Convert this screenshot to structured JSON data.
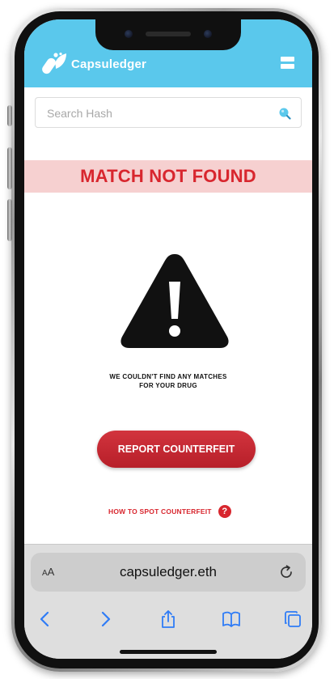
{
  "header": {
    "brand": "Capsuledger",
    "background_color": "#5ac8ec",
    "logo_icon": "capsule-leaf-logo",
    "menu_icon": "hamburger-menu-icon"
  },
  "search": {
    "placeholder": "Search Hash",
    "value": "",
    "icon": "search-icon"
  },
  "result": {
    "banner_text": "MATCH NOT FOUND",
    "banner_color": "#d8262e",
    "banner_background": "#f6d0d0",
    "icon": "warning-icon",
    "message_line1": "WE COULDN'T FIND ANY MATCHES",
    "message_line2": "FOR YOUR DRUG"
  },
  "actions": {
    "report_label": "REPORT COUNTERFEIT",
    "spot_label": "HOW TO SPOT COUNTERFEIT",
    "help_icon_glyph": "?"
  },
  "browser": {
    "text_size_label_small": "A",
    "text_size_label_large": "A",
    "url": "capsuledger.eth",
    "reload_icon": "reload-icon",
    "toolbar_icons": [
      "back-icon",
      "forward-icon",
      "share-icon",
      "bookmarks-icon",
      "tabs-icon"
    ],
    "accent_color": "#2f7cf6"
  }
}
